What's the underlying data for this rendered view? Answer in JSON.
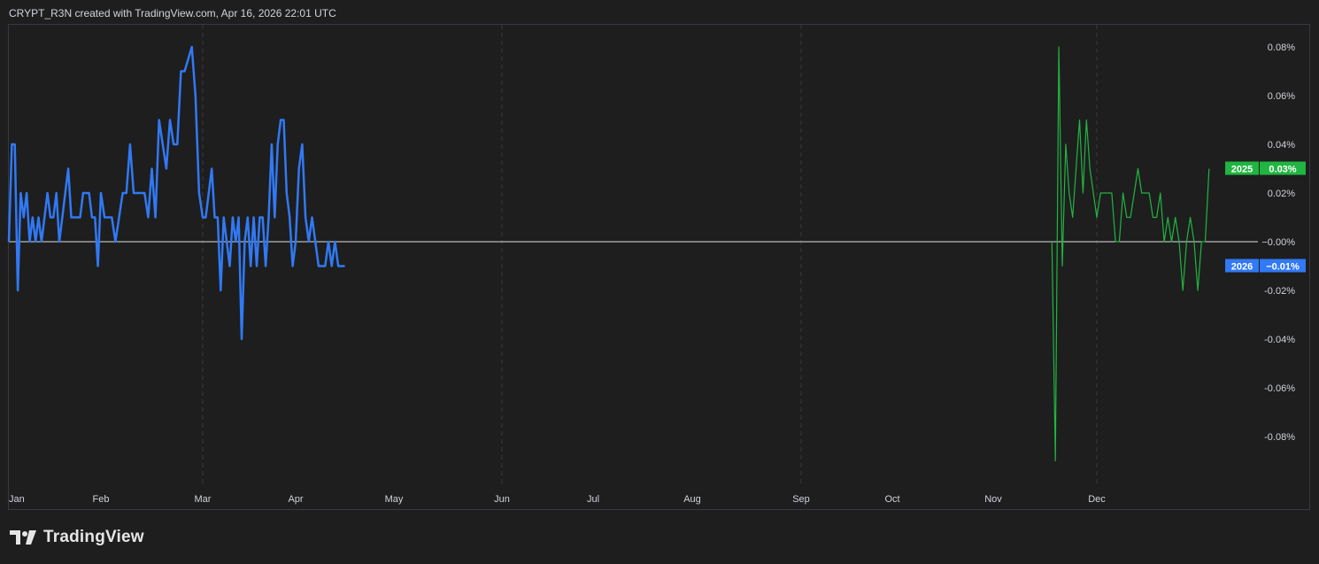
{
  "header": {
    "caption": "CRYPT_R3N created with TradingView.com, Apr 16, 2026 22:01 UTC"
  },
  "branding": {
    "logo_text": "TradingView"
  },
  "colors": {
    "background": "#1e1e1e",
    "grid": "#3a3a3a",
    "zero_line": "#e0e0e0",
    "series_2026": "#3179f5",
    "series_2025": "#21b541"
  },
  "chart_data": {
    "type": "line",
    "x_axis": {
      "tick_labels": [
        "Jan",
        "Feb",
        "Mar",
        "Apr",
        "May",
        "Jun",
        "Jul",
        "Aug",
        "Sep",
        "Oct",
        "Nov",
        "Dec"
      ],
      "vertical_dashed_grid": [
        "Mar",
        "Jun",
        "Sep",
        "Dec"
      ],
      "unit": "day-of-year"
    },
    "y_axis": {
      "position": "right",
      "ylim": [
        -0.1,
        0.09
      ],
      "ticks": [
        0.08,
        0.06,
        0.04,
        0.02,
        0.0,
        -0.02,
        -0.04,
        -0.06,
        -0.08
      ],
      "tick_labels": [
        "0.08%",
        "0.06%",
        "0.04%",
        "0.02%",
        "0.00%",
        "-0.02%",
        "-0.04%",
        "-0.06%",
        "-0.08%"
      ],
      "zero_label": "−0.00%"
    },
    "series": [
      {
        "name": "2026",
        "color": "#3179f5",
        "last_value_label": "−0.01%",
        "last_value": -0.01,
        "x": [
          1,
          2,
          3,
          4,
          5,
          6,
          7,
          8,
          9,
          10,
          11,
          12,
          13,
          14,
          15,
          16,
          17,
          18,
          19,
          20,
          21,
          22,
          23,
          24,
          25,
          26,
          27,
          28,
          29,
          30,
          31,
          32,
          33,
          34,
          35,
          36,
          37,
          38,
          39,
          40,
          41,
          42,
          43,
          44,
          45,
          46,
          47,
          48,
          49,
          50,
          51,
          52,
          53,
          54,
          55,
          56,
          57,
          58,
          59,
          60,
          61,
          62,
          63,
          64,
          65,
          66,
          67,
          68,
          69,
          70,
          71,
          72,
          73,
          74,
          75,
          76,
          77,
          78,
          79,
          80,
          81,
          82,
          83,
          84,
          85,
          86,
          87,
          88,
          89,
          90,
          91,
          92,
          93,
          94,
          95,
          96,
          97,
          98,
          99,
          100,
          101,
          102,
          103,
          104,
          105,
          106
        ],
        "y": [
          0,
          0.04,
          0.04,
          -0.02,
          0.02,
          0.01,
          0.02,
          0,
          0.01,
          0,
          0.01,
          0,
          0.01,
          0.02,
          0.01,
          0.01,
          0.02,
          0,
          0.01,
          0.02,
          0.03,
          0.01,
          0.01,
          0.01,
          0.01,
          0.02,
          0.02,
          0.02,
          0.01,
          0.01,
          -0.01,
          0.02,
          0.01,
          0.01,
          0.01,
          0,
          0.01,
          0.02,
          0.02,
          0.04,
          0.02,
          0.02,
          0.02,
          0.02,
          0.01,
          0.03,
          0.01,
          0.05,
          0.04,
          0.03,
          0.05,
          0.04,
          0.04,
          0.07,
          0.07,
          0.075,
          0.08,
          0.06,
          0.02,
          0.01,
          0.01,
          0.02,
          0.03,
          0.01,
          0.01,
          -0.02,
          0.01,
          0,
          -0.01,
          0.01,
          0,
          0.01,
          -0.04,
          0,
          0.01,
          -0.01,
          0.01,
          -0.01,
          0.01,
          0.01,
          -0.01,
          0.01,
          0.04,
          0.01,
          0.04,
          0.05,
          0.05,
          0.02,
          0.01,
          -0.01,
          0,
          0.03,
          0.04,
          0.01,
          0,
          0.01,
          0,
          -0.01,
          -0.01,
          -0.01,
          0,
          -0.01,
          0,
          -0.01,
          -0.01,
          -0.01
        ]
      },
      {
        "name": "2025",
        "color": "#21b541",
        "last_value_label": "0.03%",
        "last_value": 0.03,
        "x": [
          322,
          323,
          324,
          325,
          326,
          327,
          328,
          329,
          330,
          331,
          332,
          333,
          334,
          335,
          336,
          337,
          338,
          339,
          340,
          341,
          342,
          343,
          344,
          345,
          346,
          347,
          348,
          349,
          350,
          351,
          352,
          353,
          354,
          355,
          356,
          357,
          358,
          359,
          360,
          361,
          362,
          363,
          364,
          365
        ],
        "y": [
          0,
          -0.09,
          0.08,
          -0.01,
          0.04,
          0.02,
          0.01,
          0.03,
          0.05,
          0.02,
          0.05,
          0.03,
          0.02,
          0.01,
          0.02,
          0.02,
          0.02,
          0.02,
          0,
          0,
          0.02,
          0.01,
          0.01,
          0.02,
          0.03,
          0.02,
          0.02,
          0.02,
          0.01,
          0.01,
          0.02,
          0,
          0.01,
          0,
          0.01,
          0,
          -0.02,
          0,
          0.01,
          0,
          -0.02,
          0,
          0,
          0.03
        ]
      }
    ]
  }
}
